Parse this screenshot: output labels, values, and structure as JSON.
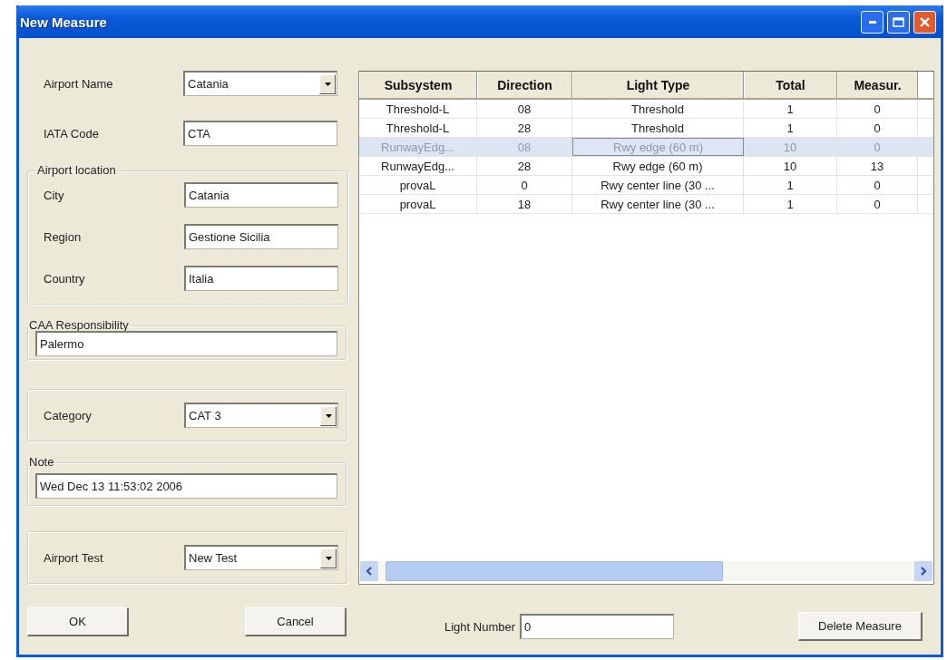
{
  "window": {
    "title": "New Measure"
  },
  "airport_name": {
    "label": "Airport Name",
    "value": "Catania",
    "kind": "dropdown"
  },
  "iata_code": {
    "label": "IATA Code",
    "value": "CTA",
    "kind": "text"
  },
  "airport_location": {
    "legend": "Airport location",
    "fields": [
      {
        "label": "City",
        "value": "Catania",
        "kind": "text"
      },
      {
        "label": "Region",
        "value": "Gestione Sicilia",
        "kind": "text"
      },
      {
        "label": "Country",
        "value": "Italia",
        "kind": "text"
      }
    ]
  },
  "caa_responsibility": {
    "legend": "CAA Responsibility",
    "value": "Palermo",
    "kind": "text"
  },
  "category": {
    "label": "Category",
    "value": "CAT 3",
    "kind": "dropdown"
  },
  "note": {
    "legend": "Note",
    "value": "Wed Dec 13 11:53:02 2006",
    "kind": "text"
  },
  "airport_test": {
    "label": "Airport Test",
    "value": "New Test",
    "kind": "dropdown"
  },
  "table": {
    "columns": [
      "Subsystem",
      "Direction",
      "Light Type",
      "Total",
      "Measur."
    ],
    "rows": [
      {
        "cells": [
          "Threshold-L",
          "08",
          "Threshold",
          "1",
          "0"
        ],
        "selected": false
      },
      {
        "cells": [
          "Threshold-L",
          "28",
          "Threshold",
          "1",
          "0"
        ],
        "selected": false
      },
      {
        "cells": [
          "RunwayEdg...",
          "08",
          "Rwy edge (60 m)",
          "10",
          "0"
        ],
        "selected": true
      },
      {
        "cells": [
          "RunwayEdg...",
          "28",
          "Rwy edge (60 m)",
          "10",
          "13"
        ],
        "selected": false
      },
      {
        "cells": [
          "provaL",
          "0",
          "Rwy center line (30 ...",
          "1",
          "0"
        ],
        "selected": false
      },
      {
        "cells": [
          "provaL",
          "18",
          "Rwy center line (30 ...",
          "1",
          "0"
        ],
        "selected": false
      }
    ]
  },
  "light_number": {
    "label": "Light Number",
    "value": "0",
    "kind": "text"
  },
  "buttons": {
    "ok": "OK",
    "cancel": "Cancel",
    "delete": "Delete Measure"
  }
}
